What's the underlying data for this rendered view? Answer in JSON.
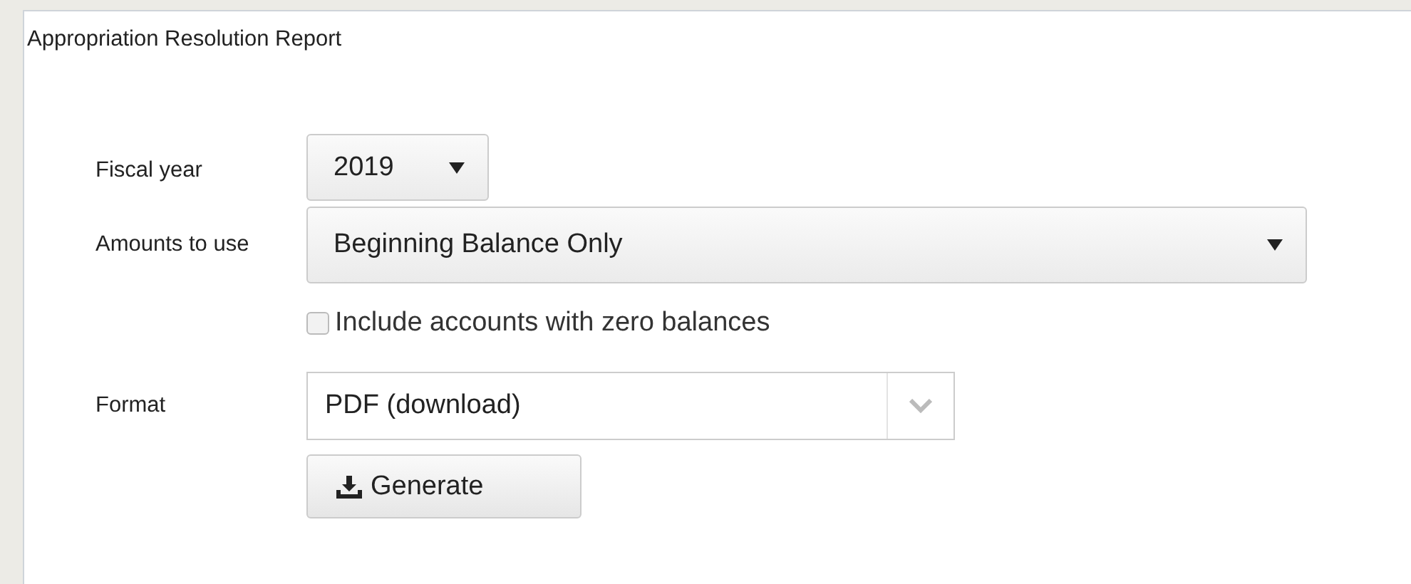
{
  "panel": {
    "title": "Appropriation Resolution Report"
  },
  "fields": [
    {
      "kind": "select",
      "label": "Fiscal year",
      "value": "2019"
    },
    {
      "kind": "select",
      "label": "Amounts to use",
      "value": "Beginning Balance Only"
    },
    {
      "kind": "checkbox",
      "label": "Include accounts with zero balances",
      "checked": false
    },
    {
      "kind": "combo",
      "label": "Format",
      "value": "PDF (download)"
    },
    {
      "kind": "button",
      "label": "Generate"
    }
  ]
}
